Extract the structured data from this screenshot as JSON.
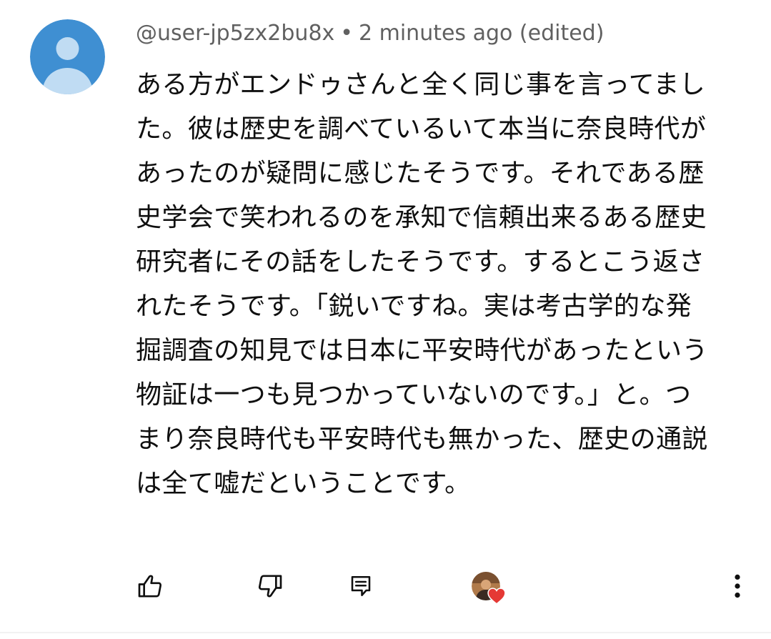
{
  "comment": {
    "author": "@user-jp5zx2bu8x",
    "separator": "•",
    "timestamp": "2 minutes ago (edited)",
    "lines": [
      "ある方がエンドゥさんと全く同じ事を言ってまし",
      "た。彼は歴史を調べているいて本当に奈良時代が",
      "あったのが疑問に感じたそうです。それである歴",
      "史学会で笑われるのを承知で信頼出来るある歴史",
      "研究者にその話をしたそうです。するとこう返さ",
      "れたそうです。「鋭いですね。実は考古学的な発",
      "掘調査の知見では日本に平安時代があったという",
      "物証は一つも見つかっていないのです。」と。つ",
      "まり奈良時代も平安時代も無かった、歴史の通説",
      "は全て嘘だということです。"
    ]
  },
  "icons": {
    "avatar": "default-user-avatar-icon",
    "like": "thumbs-up-icon",
    "dislike": "thumbs-down-icon",
    "reply": "reply-icon",
    "hearted": "creator-heart-icon",
    "more": "more-vertical-icon"
  },
  "colors": {
    "avatar_bg": "#3f8fd2",
    "avatar_fg": "#c0dcf3",
    "meta_text": "#606060",
    "body_text": "#0f0f0f",
    "heart": "#e53935"
  }
}
